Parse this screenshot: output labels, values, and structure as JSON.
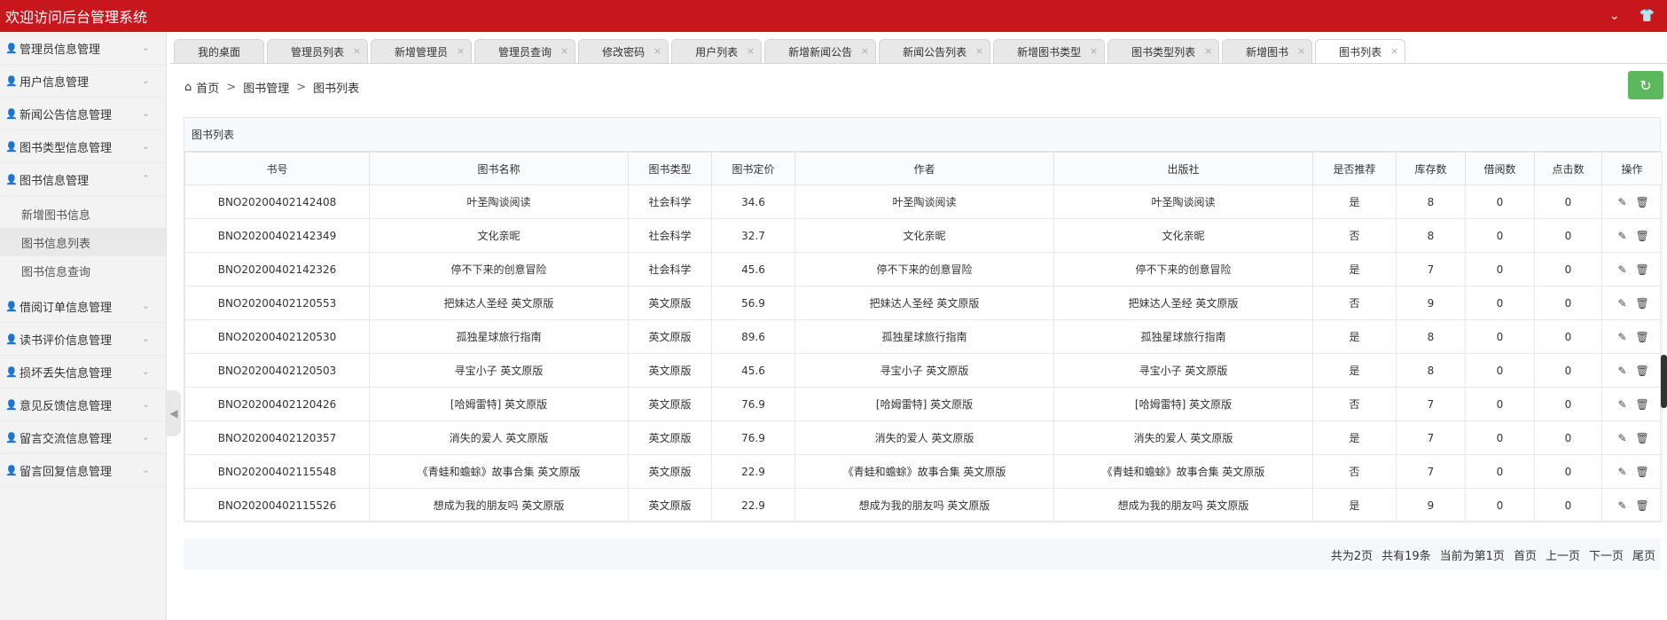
{
  "header": {
    "title": "欢迎访问后台管理系统"
  },
  "sidebar": {
    "items": [
      {
        "label": "管理员信息管理"
      },
      {
        "label": "用户信息管理"
      },
      {
        "label": "新闻公告信息管理"
      },
      {
        "label": "图书类型信息管理"
      },
      {
        "label": "图书信息管理"
      }
    ],
    "subitems": [
      {
        "label": "新增图书信息"
      },
      {
        "label": "图书信息列表"
      },
      {
        "label": "图书信息查询"
      }
    ],
    "items_after": [
      {
        "label": "借阅订单信息管理"
      },
      {
        "label": "读书评价信息管理"
      },
      {
        "label": "损坏丢失信息管理"
      },
      {
        "label": "意见反馈信息管理"
      },
      {
        "label": "留言交流信息管理"
      },
      {
        "label": "留言回复信息管理"
      }
    ]
  },
  "tabs": [
    {
      "label": "我的桌面"
    },
    {
      "label": "管理员列表"
    },
    {
      "label": "新增管理员"
    },
    {
      "label": "管理员查询"
    },
    {
      "label": "修改密码"
    },
    {
      "label": "用户列表"
    },
    {
      "label": "新增新闻公告"
    },
    {
      "label": "新闻公告列表"
    },
    {
      "label": "新增图书类型"
    },
    {
      "label": "图书类型列表"
    },
    {
      "label": "新增图书"
    },
    {
      "label": "图书列表"
    }
  ],
  "breadcrumb": {
    "home": "首页",
    "level1": "图书管理",
    "level2": "图书列表"
  },
  "panel": {
    "title": "图书列表"
  },
  "table": {
    "headers": [
      "书号",
      "图书名称",
      "图书类型",
      "图书定价",
      "作者",
      "出版社",
      "是否推荐",
      "库存数",
      "借阅数",
      "点击数",
      "操作"
    ],
    "rows": [
      [
        "BNO20200402142408",
        "叶圣陶谈阅读",
        "社会科学",
        "34.6",
        "叶圣陶谈阅读",
        "叶圣陶谈阅读",
        "是",
        "8",
        "0",
        "0"
      ],
      [
        "BNO20200402142349",
        "文化亲昵",
        "社会科学",
        "32.7",
        "文化亲昵",
        "文化亲昵",
        "否",
        "8",
        "0",
        "0"
      ],
      [
        "BNO20200402142326",
        "停不下来的创意冒险",
        "社会科学",
        "45.6",
        "停不下来的创意冒险",
        "停不下来的创意冒险",
        "是",
        "7",
        "0",
        "0"
      ],
      [
        "BNO20200402120553",
        "把妹达人圣经 英文原版",
        "英文原版",
        "56.9",
        "把妹达人圣经 英文原版",
        "把妹达人圣经 英文原版",
        "否",
        "9",
        "0",
        "0"
      ],
      [
        "BNO20200402120530",
        "孤独星球旅行指南",
        "英文原版",
        "89.6",
        "孤独星球旅行指南",
        "孤独星球旅行指南",
        "是",
        "8",
        "0",
        "0"
      ],
      [
        "BNO20200402120503",
        "寻宝小子 英文原版",
        "英文原版",
        "45.6",
        "寻宝小子 英文原版",
        "寻宝小子 英文原版",
        "是",
        "8",
        "0",
        "0"
      ],
      [
        "BNO20200402120426",
        "[哈姆雷特] 英文原版",
        "英文原版",
        "76.9",
        "[哈姆雷特] 英文原版",
        "[哈姆雷特] 英文原版",
        "否",
        "7",
        "0",
        "0"
      ],
      [
        "BNO20200402120357",
        "消失的爱人 英文原版",
        "英文原版",
        "76.9",
        "消失的爱人 英文原版",
        "消失的爱人 英文原版",
        "是",
        "7",
        "0",
        "0"
      ],
      [
        "BNO20200402115548",
        "《青蛙和蟾蜍》故事合集 英文原版",
        "英文原版",
        "22.9",
        "《青蛙和蟾蜍》故事合集 英文原版",
        "《青蛙和蟾蜍》故事合集 英文原版",
        "否",
        "7",
        "0",
        "0"
      ],
      [
        "BNO20200402115526",
        "想成为我的朋友吗 英文原版",
        "英文原版",
        "22.9",
        "想成为我的朋友吗 英文原版",
        "想成为我的朋友吗 英文原版",
        "是",
        "9",
        "0",
        "0"
      ]
    ]
  },
  "pager": {
    "total_pages": "共为2页",
    "total_records": "共有19条",
    "current": "当前为第1页",
    "first": "首页",
    "prev": "上一页",
    "next": "下一页",
    "last": "尾页"
  },
  "colors": {
    "brand": "#c8161d",
    "refresh": "#5cb85c"
  },
  "icons": {
    "edit": "pencil-icon",
    "delete": "trash-icon",
    "home": "home-icon",
    "user": "user-icon",
    "refresh": "refresh-icon",
    "shirt": "shirt-icon"
  }
}
